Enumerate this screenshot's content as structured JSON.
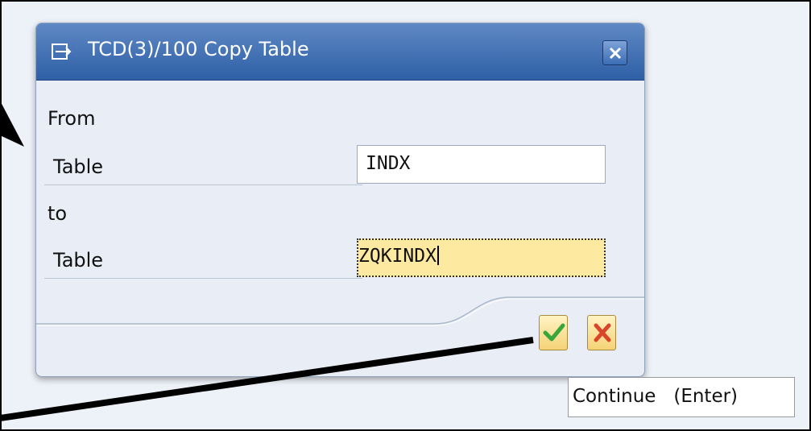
{
  "dialog": {
    "title": "TCD(3)/100 Copy Table",
    "close_icon": "close-icon",
    "title_icon": "dialog-icon"
  },
  "form": {
    "from_label": "From",
    "from_table_label": "Table",
    "from_table_value": "INDX",
    "to_label": "to",
    "to_table_label": "Table",
    "to_table_value": "ZQKINDX"
  },
  "buttons": {
    "continue_icon": "checkmark-icon",
    "cancel_icon": "cancel-x-icon"
  },
  "tooltip": {
    "text": "Continue   (Enter)"
  },
  "colors": {
    "title_bar": "#2e5fa6",
    "focused_field": "#fde9a0",
    "continue_check": "#3aa53a",
    "cancel_x": "#d8452b"
  }
}
